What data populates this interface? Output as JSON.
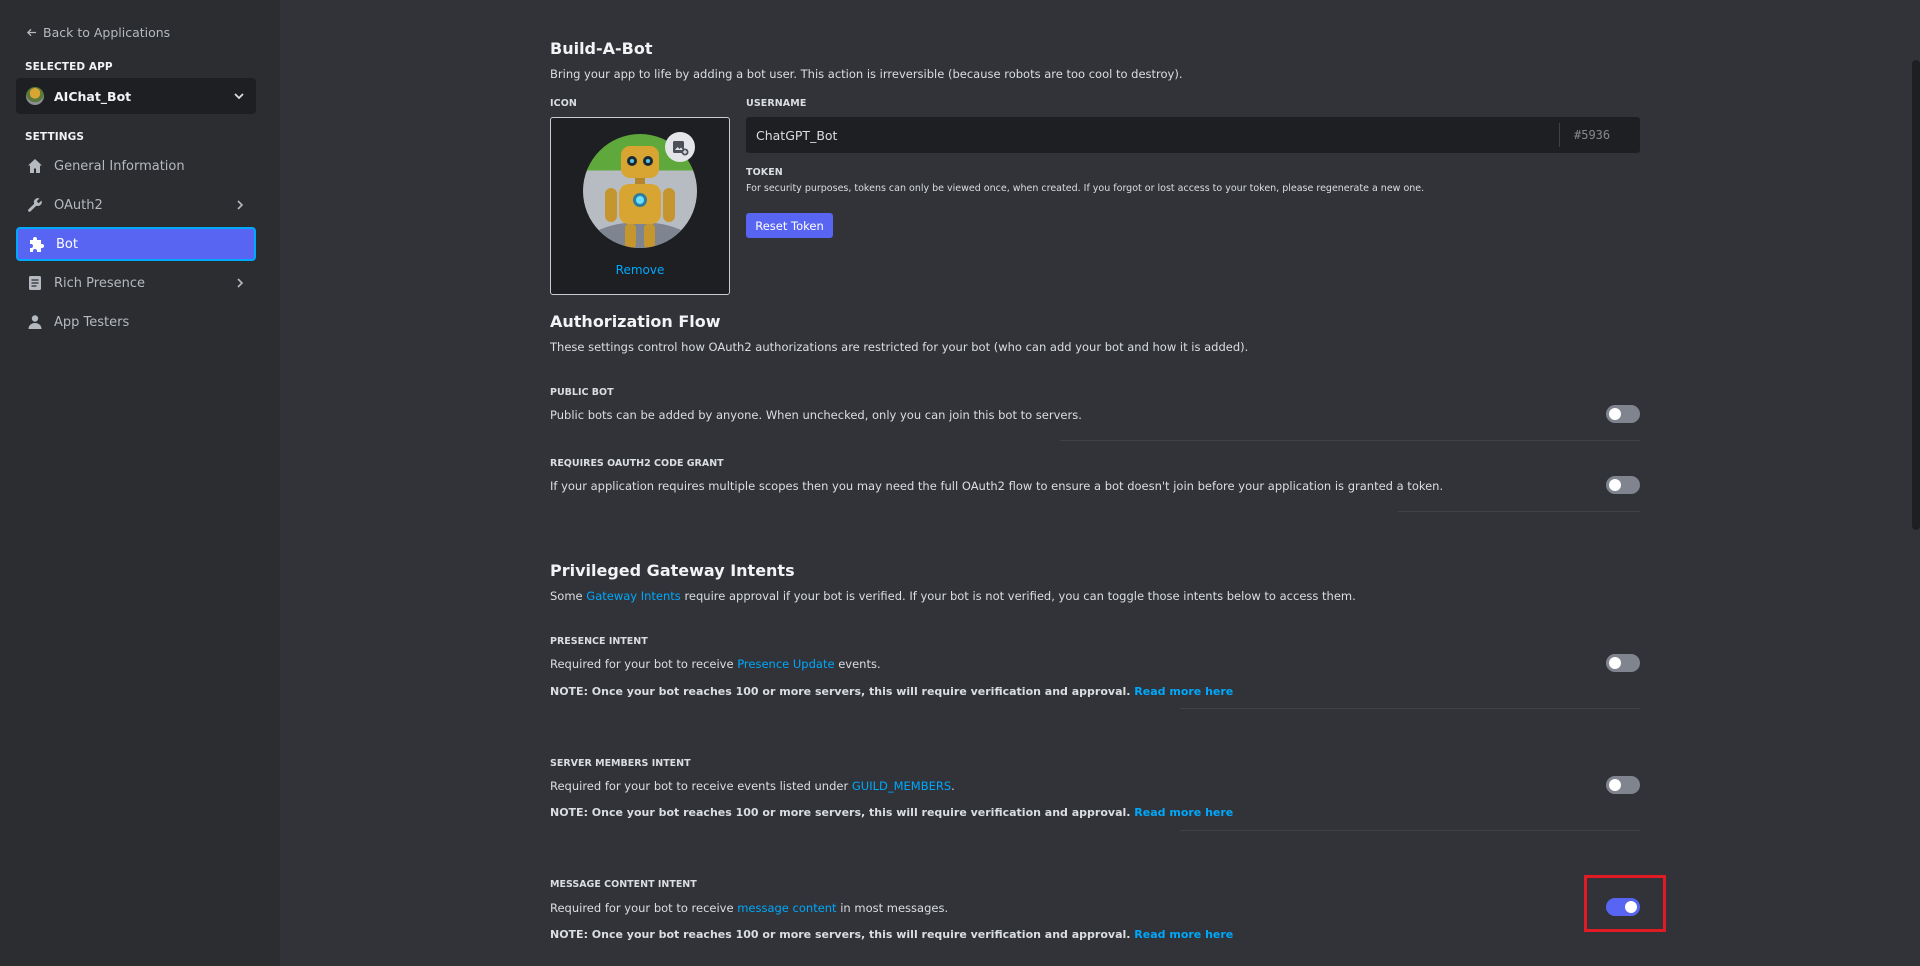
{
  "sidebar": {
    "back_label": "Back to Applications",
    "selected_app_label": "SELECTED APP",
    "app_name": "AIChat_Bot",
    "settings_label": "SETTINGS",
    "items": [
      {
        "label": "General Information",
        "icon": "home-icon"
      },
      {
        "label": "OAuth2",
        "icon": "wrench-icon"
      },
      {
        "label": "Bot",
        "icon": "puzzle-icon"
      },
      {
        "label": "Rich Presence",
        "icon": "document-icon"
      },
      {
        "label": "App Testers",
        "icon": "person-icon"
      }
    ]
  },
  "build_a_bot": {
    "title": "Build-A-Bot",
    "description": "Bring your app to life by adding a bot user. This action is irreversible (because robots are too cool to destroy).",
    "icon_label": "ICON",
    "remove_label": "Remove",
    "username_label": "USERNAME",
    "username_value": "ChatGPT_Bot",
    "discriminator": "#5936",
    "token_label": "TOKEN",
    "token_desc": "For security purposes, tokens can only be viewed once, when created. If you forgot or lost access to your token, please regenerate a new one.",
    "reset_token_label": "Reset Token"
  },
  "auth_flow": {
    "title": "Authorization Flow",
    "description": "These settings control how OAuth2 authorizations are restricted for your bot (who can add your bot and how it is added).",
    "public_bot": {
      "title": "PUBLIC BOT",
      "text": "Public bots can be added by anyone. When unchecked, only you can join this bot to servers.",
      "enabled": false
    },
    "code_grant": {
      "title": "REQUIRES OAUTH2 CODE GRANT",
      "text": "If your application requires multiple scopes then you may need the full OAuth2 flow to ensure a bot doesn't join before your application is granted a token.",
      "enabled": false
    }
  },
  "intents": {
    "title": "Privileged Gateway Intents",
    "desc_before": "Some ",
    "desc_link": "Gateway Intents",
    "desc_after": " require approval if your bot is verified. If your bot is not verified, you can toggle those intents below to access them.",
    "note_text": "NOTE: Once your bot reaches 100 or more servers, this will require verification and approval.",
    "note_link": "Read more here",
    "presence": {
      "title": "PRESENCE INTENT",
      "before": "Required for your bot to receive ",
      "link": "Presence Update",
      "after": " events.",
      "enabled": false
    },
    "members": {
      "title": "SERVER MEMBERS INTENT",
      "before": "Required for your bot to receive events listed under ",
      "link": "GUILD_MEMBERS",
      "after": ".",
      "enabled": false
    },
    "message_content": {
      "title": "MESSAGE CONTENT INTENT",
      "before": "Required for your bot to receive ",
      "link": "message content",
      "after": " in most messages.",
      "enabled": true
    }
  },
  "colors": {
    "accent": "#5865f2",
    "link": "#00a8fc",
    "highlight": "#e01b24"
  }
}
